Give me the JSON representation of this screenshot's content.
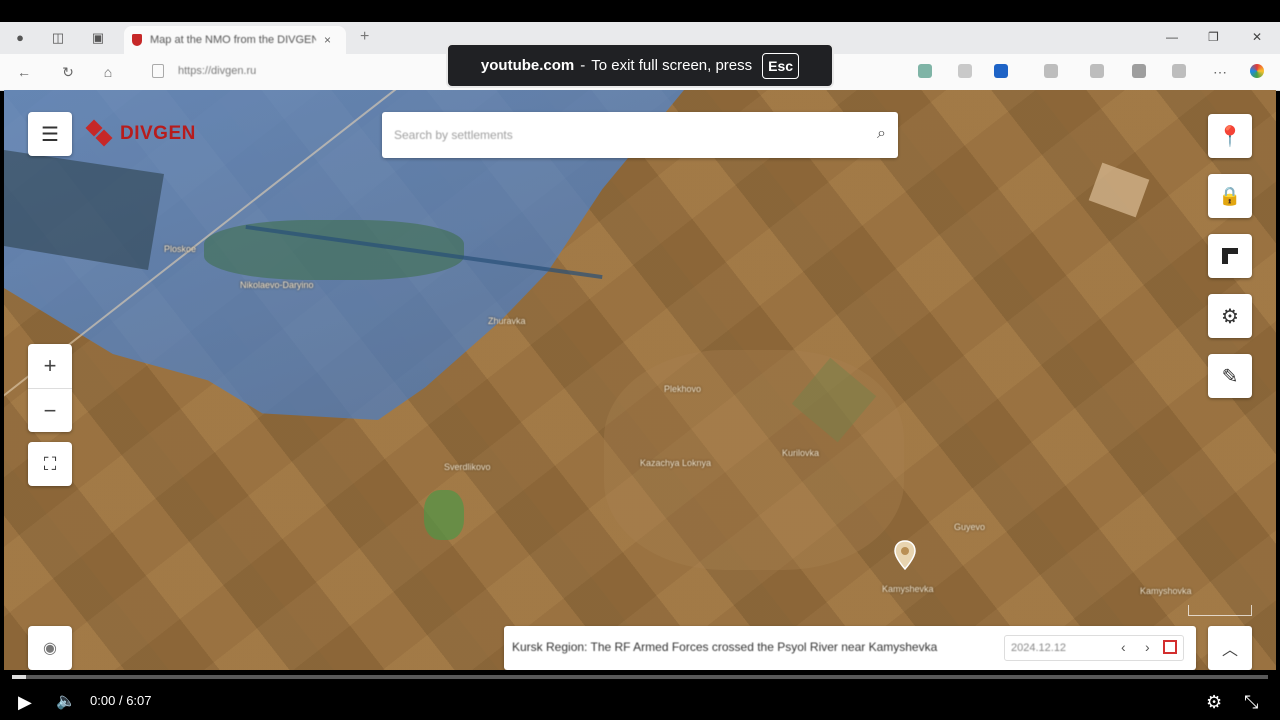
{
  "browser": {
    "tab_title": "Map at the NMO from the DIVGEN",
    "tab_close": "×",
    "new_tab": "+",
    "url": "https://divgen.ru",
    "window_controls": {
      "minimize": "—",
      "restore": "❐",
      "close": "✕"
    }
  },
  "fullscreen_toast": {
    "domain": "youtube.com",
    "separator": "-",
    "message": "To exit full screen, press",
    "key": "Esc"
  },
  "map": {
    "logo_text": "DIVGEN",
    "search_placeholder": "Search by settlements",
    "zoom_in": "+",
    "zoom_out": "−",
    "towns": [
      "Ploskoe",
      "Nikolaevo-Daryino",
      "Zhuravka",
      "Plekhovo",
      "Kazachya Loknya",
      "Kurilovka",
      "Sverdlikovo",
      "Kamyshevka",
      "Guyevo",
      "Kamyshovka"
    ],
    "info_caption": "Kursk Region: The RF Armed Forces crossed the Psyol River near Kamyshevka",
    "info_date": "2024.12.12",
    "colors": {
      "occupied_overlay": "#5b8fd6",
      "accent": "#c62828"
    }
  },
  "player": {
    "time_current": "0:00",
    "time_separator": "/",
    "time_total": "6:07",
    "progress_fraction": 0.0
  }
}
